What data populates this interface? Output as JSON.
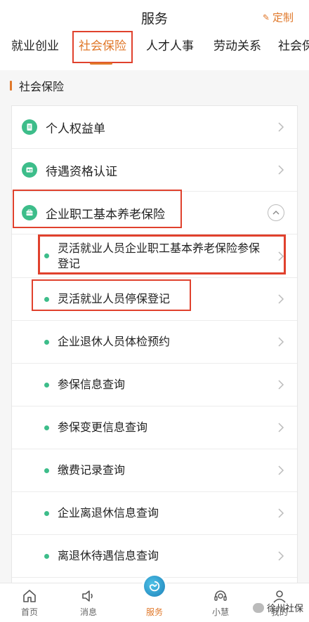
{
  "header": {
    "title": "服务",
    "custom_label": "定制"
  },
  "tabs": [
    {
      "label": "就业创业",
      "active": false
    },
    {
      "label": "社会保险",
      "active": true
    },
    {
      "label": "人才人事",
      "active": false
    },
    {
      "label": "劳动关系",
      "active": false
    },
    {
      "label": "社会保",
      "active": false
    }
  ],
  "section": {
    "title": "社会保险"
  },
  "list": {
    "items": [
      {
        "label": "个人权益单",
        "icon": "document-icon"
      },
      {
        "label": "待遇资格认证",
        "icon": "id-card-icon"
      },
      {
        "label": "企业职工基本养老保险",
        "icon": "briefcase-icon",
        "expanded": true
      }
    ],
    "sub_items": [
      {
        "label_line1": "灵活就业人员企业职工基本养老保险参保",
        "label_line2": "登记"
      },
      {
        "label": "灵活就业人员停保登记"
      },
      {
        "label": "企业退休人员体检预约"
      },
      {
        "label": "参保信息查询"
      },
      {
        "label": "参保变更信息查询"
      },
      {
        "label": "缴费记录查询"
      },
      {
        "label": "企业离退休信息查询"
      },
      {
        "label": "离退休待遇信息查询"
      }
    ]
  },
  "bottom_nav": [
    {
      "label": "首页",
      "icon": "home-icon"
    },
    {
      "label": "消息",
      "icon": "speaker-icon"
    },
    {
      "label": "服务",
      "icon": "service-logo-icon",
      "active": true
    },
    {
      "label": "小慧",
      "icon": "headset-icon"
    },
    {
      "label": "我的",
      "icon": "user-icon"
    }
  ],
  "watermark": "徐州社保",
  "colors": {
    "accent": "#e0782a",
    "green": "#3dbd8a",
    "highlight_red": "#e0412d"
  }
}
